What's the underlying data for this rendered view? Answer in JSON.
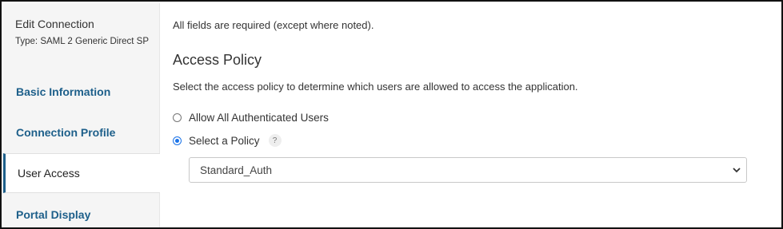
{
  "sidebar": {
    "title": "Edit Connection",
    "subtitle": "Type: SAML 2 Generic Direct SP",
    "items": [
      {
        "label": "Basic Information",
        "active": false
      },
      {
        "label": "Connection Profile",
        "active": false
      },
      {
        "label": "User Access",
        "active": true
      },
      {
        "label": "Portal Display",
        "active": false
      }
    ]
  },
  "main": {
    "note": "All fields are required (except where noted).",
    "section_title": "Access Policy",
    "description": "Select the access policy to determine which users are allowed to access the application.",
    "options": [
      {
        "label": "Allow All Authenticated Users",
        "selected": false
      },
      {
        "label": "Select a Policy",
        "selected": true
      }
    ],
    "help_label": "?",
    "policy_select": {
      "value": "Standard_Auth"
    }
  },
  "colors": {
    "link": "#1d5f8a",
    "radio_selected": "#1a73e8",
    "sidebar_bg": "#f5f5f5"
  }
}
